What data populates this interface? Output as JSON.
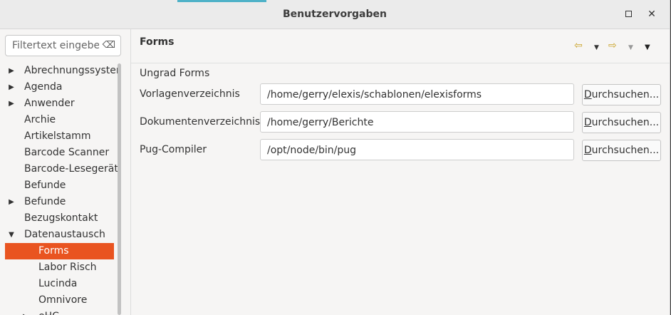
{
  "window": {
    "title": "Benutzervorgaben",
    "maximize_icon": "maximize-icon",
    "close_icon": "close-icon",
    "close_glyph": "✕"
  },
  "sidebar": {
    "filter": {
      "placeholder": "Filtertext eingeben",
      "clear_glyph": "⌫"
    },
    "items": [
      {
        "label": "Abrechnungssystem",
        "expander": "collapsed",
        "level": 0
      },
      {
        "label": "Agenda",
        "expander": "collapsed",
        "level": 0
      },
      {
        "label": "Anwender",
        "expander": "collapsed",
        "level": 0
      },
      {
        "label": "Archie",
        "expander": "none",
        "level": 0
      },
      {
        "label": "Artikelstamm",
        "expander": "none",
        "level": 0
      },
      {
        "label": "Barcode Scanner",
        "expander": "none",
        "level": 0
      },
      {
        "label": "Barcode-Lesegerät",
        "expander": "none",
        "level": 0
      },
      {
        "label": "Befunde",
        "expander": "none",
        "level": 0
      },
      {
        "label": "Befunde",
        "expander": "collapsed",
        "level": 0
      },
      {
        "label": "Bezugskontakt",
        "expander": "none",
        "level": 0
      },
      {
        "label": "Datenaustausch",
        "expander": "expanded",
        "level": 0
      },
      {
        "label": "Forms",
        "expander": "none",
        "level": 1,
        "selected": true
      },
      {
        "label": "Labor Risch",
        "expander": "none",
        "level": 1
      },
      {
        "label": "Lucinda",
        "expander": "none",
        "level": 1
      },
      {
        "label": "Omnivore",
        "expander": "none",
        "level": 1
      },
      {
        "label": "eHC",
        "expander": "collapsed",
        "level": 1
      }
    ]
  },
  "content": {
    "title": "Forms",
    "toolbar": {
      "back_glyph": "⇦",
      "forward_glyph": "⇨",
      "dropdown_glyph": "▼",
      "view_menu_glyph": "▼"
    },
    "section_label": "Ungrad Forms",
    "rows": [
      {
        "label": "Vorlagenverzeichnis",
        "value": "/home/gerry/elexis/schablonen/elexisforms",
        "button_mnemonic": "D",
        "button_rest": "urchsuchen..."
      },
      {
        "label": "Dokumentenverzeichnis",
        "value": "/home/gerry/Berichte",
        "button_mnemonic": "D",
        "button_rest": "urchsuchen..."
      },
      {
        "label": "Pug-Compiler",
        "value": "/opt/node/bin/pug",
        "button_mnemonic": "D",
        "button_rest": "urchsuchen..."
      }
    ]
  },
  "colors": {
    "selection": "#e95420",
    "nav_arrow": "#c9a227",
    "accent_strip": "#4fb2c8"
  }
}
